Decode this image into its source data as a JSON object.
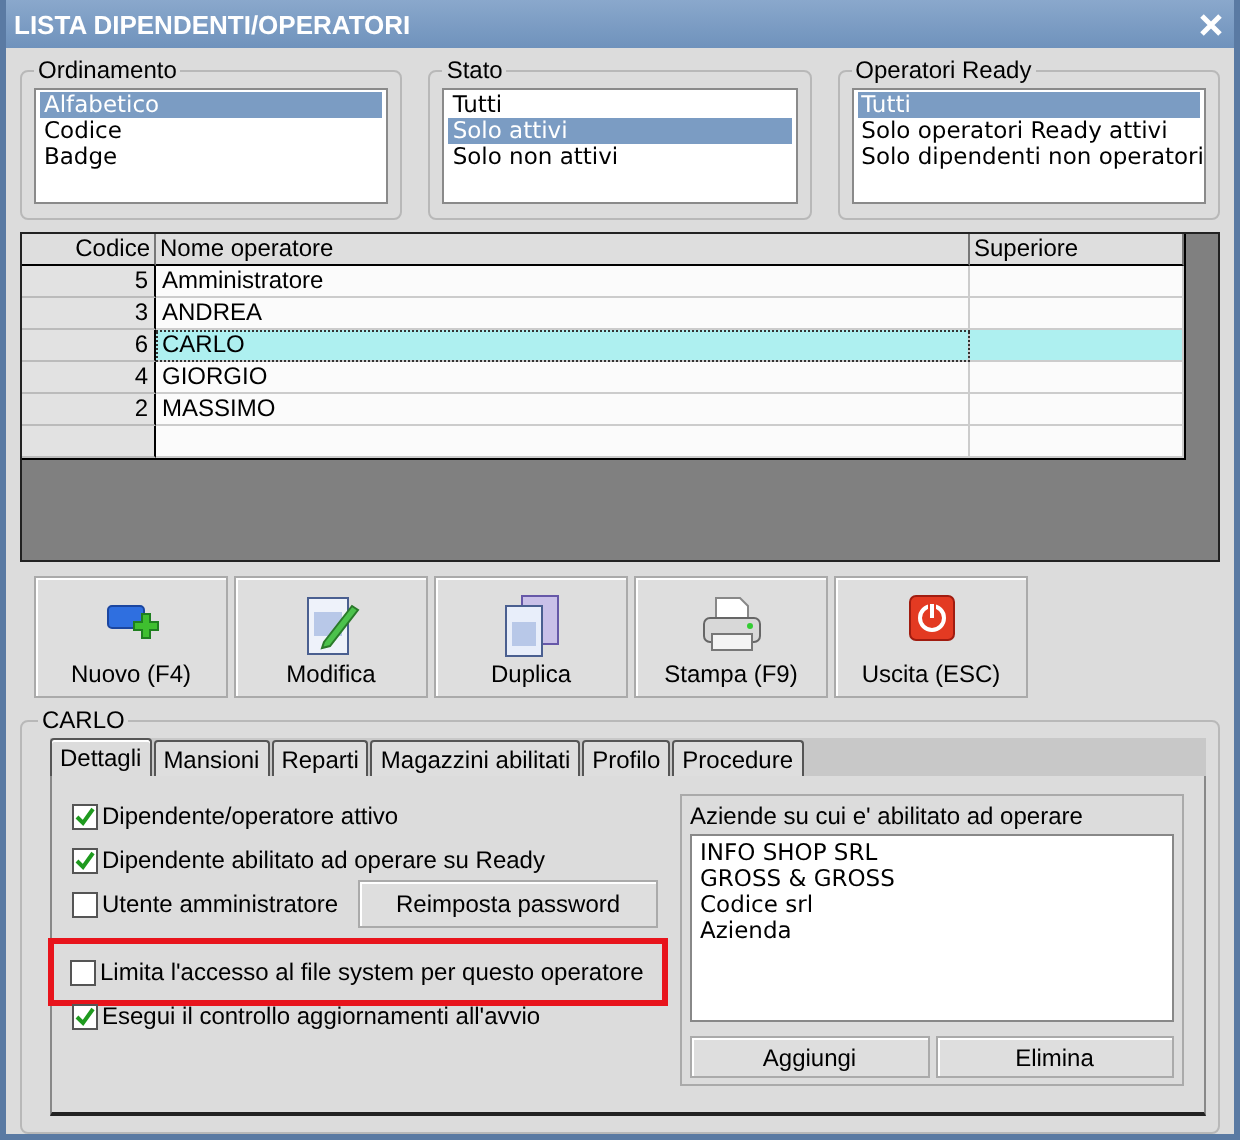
{
  "window": {
    "title": "LISTA DIPENDENTI/OPERATORI"
  },
  "filters": [
    {
      "title": "Ordinamento",
      "options": [
        {
          "label": "Alfabetico",
          "selected": true
        },
        {
          "label": "Codice",
          "selected": false
        },
        {
          "label": "Badge",
          "selected": false
        }
      ]
    },
    {
      "title": "Stato",
      "options": [
        {
          "label": "Tutti",
          "selected": false
        },
        {
          "label": "Solo attivi",
          "selected": true
        },
        {
          "label": "Solo non attivi",
          "selected": false
        }
      ]
    },
    {
      "title": "Operatori Ready",
      "options": [
        {
          "label": "Tutti",
          "selected": true
        },
        {
          "label": "Solo operatori Ready attivi",
          "selected": false
        },
        {
          "label": "Solo dipendenti non operatori",
          "selected": false
        }
      ]
    }
  ],
  "table": {
    "columns": [
      "Codice",
      "Nome operatore",
      "Superiore"
    ],
    "rows": [
      {
        "code": "5",
        "name": "Amministratore",
        "selected": false
      },
      {
        "code": "3",
        "name": "ANDREA",
        "selected": false
      },
      {
        "code": "6",
        "name": "CARLO",
        "selected": true
      },
      {
        "code": "4",
        "name": "GIORGIO",
        "selected": false
      },
      {
        "code": "2",
        "name": "MASSIMO",
        "selected": false
      }
    ]
  },
  "buttons": [
    {
      "label": "Nuovo (F4)",
      "kind": "new"
    },
    {
      "label": "Modifica",
      "kind": "edit"
    },
    {
      "label": "Duplica",
      "kind": "copy"
    },
    {
      "label": "Stampa (F9)",
      "kind": "print"
    },
    {
      "label": "Uscita (ESC)",
      "kind": "exit"
    }
  ],
  "detail": {
    "title": "CARLO",
    "tabs": [
      {
        "label": "Dettagli",
        "selected": true
      },
      {
        "label": "Mansioni",
        "selected": false
      },
      {
        "label": "Reparti",
        "selected": false
      },
      {
        "label": "Magazzini abilitati",
        "selected": false
      },
      {
        "label": "Profilo",
        "selected": false
      },
      {
        "label": "Procedure",
        "selected": false
      }
    ],
    "checkboxes": [
      {
        "label": "Dipendente/operatore attivo",
        "checked": true,
        "highlighted": false
      },
      {
        "label": "Dipendente abilitato ad operare su Ready",
        "checked": true,
        "highlighted": false
      },
      {
        "label": "Utente amministratore",
        "checked": false,
        "highlighted": false,
        "button": "Reimposta password"
      },
      {
        "label": "Limita l'accesso al file system per questo operatore",
        "checked": false,
        "highlighted": true
      },
      {
        "label": "Esegui il controllo aggiornamenti all'avvio",
        "checked": true,
        "highlighted": false
      }
    ],
    "companies": {
      "title": "Aziende su cui e' abilitato ad operare",
      "items": [
        "INFO SHOP SRL",
        "GROSS & GROSS",
        "Codice srl",
        "Azienda"
      ],
      "buttons": [
        "Aggiungi",
        "Elimina"
      ]
    }
  }
}
